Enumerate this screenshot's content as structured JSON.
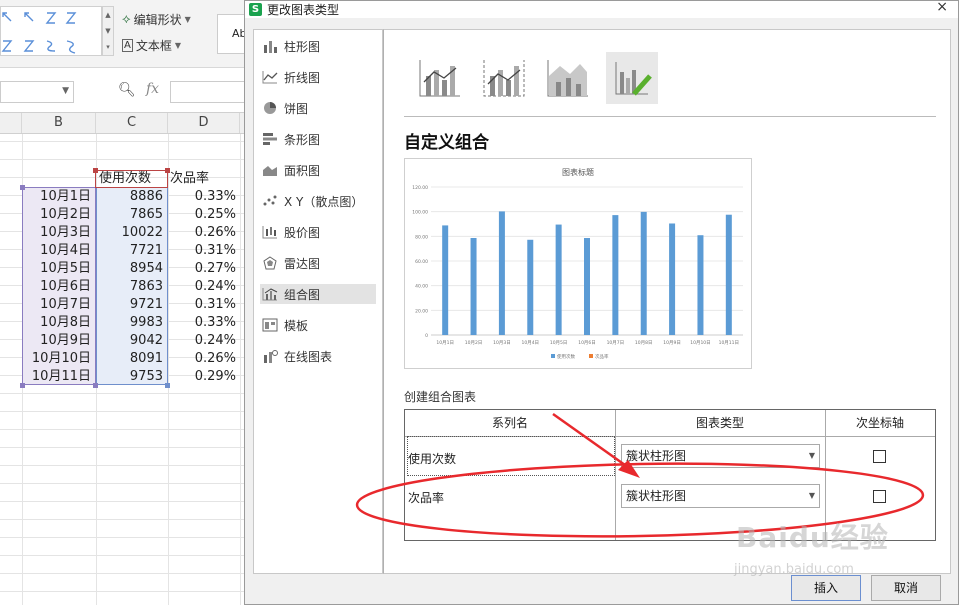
{
  "ribbon": {
    "edit_shape": "编辑形状",
    "textbox": "文本框",
    "abc_partial": "Ab"
  },
  "formula": {
    "fx": "fx"
  },
  "columns": [
    "B",
    "C",
    "D"
  ],
  "sheet": {
    "header_use": "使用次数",
    "header_rate": "次品率",
    "rows": [
      {
        "date": "10月1日",
        "use": "8886",
        "rate": "0.33%"
      },
      {
        "date": "10月2日",
        "use": "7865",
        "rate": "0.25%"
      },
      {
        "date": "10月3日",
        "use": "10022",
        "rate": "0.26%"
      },
      {
        "date": "10月4日",
        "use": "7721",
        "rate": "0.31%"
      },
      {
        "date": "10月5日",
        "use": "8954",
        "rate": "0.27%"
      },
      {
        "date": "10月6日",
        "use": "7863",
        "rate": "0.24%"
      },
      {
        "date": "10月7日",
        "use": "9721",
        "rate": "0.31%"
      },
      {
        "date": "10月8日",
        "use": "9983",
        "rate": "0.33%"
      },
      {
        "date": "10月9日",
        "use": "9042",
        "rate": "0.24%"
      },
      {
        "date": "10月10日",
        "use": "8091",
        "rate": "0.26%"
      },
      {
        "date": "10月11日",
        "use": "9753",
        "rate": "0.29%"
      }
    ]
  },
  "dialog": {
    "title": "更改图表类型",
    "close": "×",
    "nav": [
      {
        "label": "柱形图",
        "icon": "column-chart-icon"
      },
      {
        "label": "折线图",
        "icon": "line-chart-icon"
      },
      {
        "label": "饼图",
        "icon": "pie-chart-icon"
      },
      {
        "label": "条形图",
        "icon": "bar-chart-icon"
      },
      {
        "label": "面积图",
        "icon": "area-chart-icon"
      },
      {
        "label": "X Y（散点图）",
        "icon": "scatter-chart-icon"
      },
      {
        "label": "股价图",
        "icon": "stock-chart-icon"
      },
      {
        "label": "雷达图",
        "icon": "radar-chart-icon"
      },
      {
        "label": "组合图",
        "icon": "combo-chart-icon"
      },
      {
        "label": "模板",
        "icon": "template-icon"
      },
      {
        "label": "在线图表",
        "icon": "online-chart-icon"
      }
    ],
    "active_nav": "组合图",
    "section_title": "自定义组合",
    "create_label": "创建组合图表",
    "table_headers": {
      "series": "系列名",
      "type": "图表类型",
      "secondary": "次坐标轴"
    },
    "series_rows": [
      {
        "name": "使用次数",
        "type": "簇状柱形图",
        "secondary": false
      },
      {
        "name": "次品率",
        "type": "簇状柱形图",
        "secondary": false
      }
    ],
    "insert_button": "插入",
    "cancel_button": "取消"
  },
  "chart_data": {
    "type": "bar",
    "title": "图表标题",
    "categories": [
      "10月1日",
      "10月2日",
      "10月3日",
      "10月4日",
      "10月5日",
      "10月6日",
      "10月7日",
      "10月8日",
      "10月9日",
      "10月10日",
      "10月11日"
    ],
    "series": [
      {
        "name": "使用次数",
        "values": [
          8886,
          7865,
          10022,
          7721,
          8954,
          7863,
          9721,
          9983,
          9042,
          8091,
          9753
        ],
        "color": "#5b9bd5"
      },
      {
        "name": "次品率",
        "values": [
          0.0033,
          0.0025,
          0.0026,
          0.0031,
          0.0027,
          0.0024,
          0.0031,
          0.0033,
          0.0024,
          0.0026,
          0.0029
        ],
        "color": "#ed7d31"
      }
    ],
    "yticks": [
      "0",
      "20.00",
      "40.00",
      "60.00",
      "80.00",
      "100.00",
      "120.00"
    ],
    "ylim": [
      0,
      12000
    ],
    "grid": true,
    "legend": "bottom"
  },
  "colors": {
    "accent_green": "#1aa24e",
    "bar_blue": "#5b9bd5",
    "annotation_red": "#e8292d"
  },
  "watermark": {
    "brand": "Baidu经验",
    "url": "jingyan.baidu.com"
  }
}
